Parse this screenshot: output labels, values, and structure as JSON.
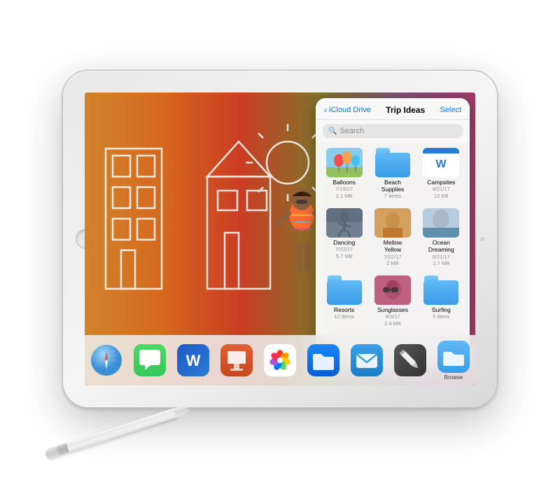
{
  "scene": {
    "background": "#f5f5f5"
  },
  "ipad": {
    "shell_color": "#e8e8e8"
  },
  "files_panel": {
    "nav": {
      "back_label": "iCloud Drive",
      "title": "Trip Ideas",
      "select_label": "Select"
    },
    "search": {
      "placeholder": "Search"
    },
    "items": [
      {
        "id": "balloons",
        "name": "Balloons",
        "meta_line1": "7/15/17",
        "meta_line2": "2.1 MB",
        "type": "photo"
      },
      {
        "id": "beach-supplies",
        "name": "Beach Supplies",
        "meta_line1": "7 items",
        "meta_line2": "",
        "type": "folder"
      },
      {
        "id": "campsites",
        "name": "Campsites",
        "meta_line1": "8/21/17",
        "meta_line2": "12 KB",
        "type": "word"
      },
      {
        "id": "dancing",
        "name": "Dancing",
        "meta_line1": "7/22/17",
        "meta_line2": "5.7 MB",
        "type": "photo"
      },
      {
        "id": "mellow-yellow",
        "name": "Mellow Yellow",
        "meta_line1": "7/22/17",
        "meta_line2": "2 MB",
        "type": "photo"
      },
      {
        "id": "ocean-dreaming",
        "name": "Ocean Dreaming",
        "meta_line1": "8/21/17",
        "meta_line2": "2.7 MB",
        "type": "photo"
      },
      {
        "id": "resorts",
        "name": "Resorts",
        "meta_line1": "12 items",
        "meta_line2": "",
        "type": "folder"
      },
      {
        "id": "sunglasses",
        "name": "Sunglasses",
        "meta_line1": "8/3/17",
        "meta_line2": "2.4 MB",
        "type": "photo"
      },
      {
        "id": "surfing",
        "name": "Surfing",
        "meta_line1": "5 items",
        "meta_line2": "",
        "type": "folder"
      }
    ]
  },
  "dock": {
    "items": [
      {
        "id": "safari",
        "label": ""
      },
      {
        "id": "messages",
        "label": ""
      },
      {
        "id": "word",
        "label": ""
      },
      {
        "id": "keynote",
        "label": ""
      },
      {
        "id": "photos",
        "label": ""
      },
      {
        "id": "files",
        "label": ""
      },
      {
        "id": "mail",
        "label": ""
      },
      {
        "id": "marker",
        "label": ""
      },
      {
        "id": "browse-folder",
        "label": "Browse"
      }
    ]
  }
}
